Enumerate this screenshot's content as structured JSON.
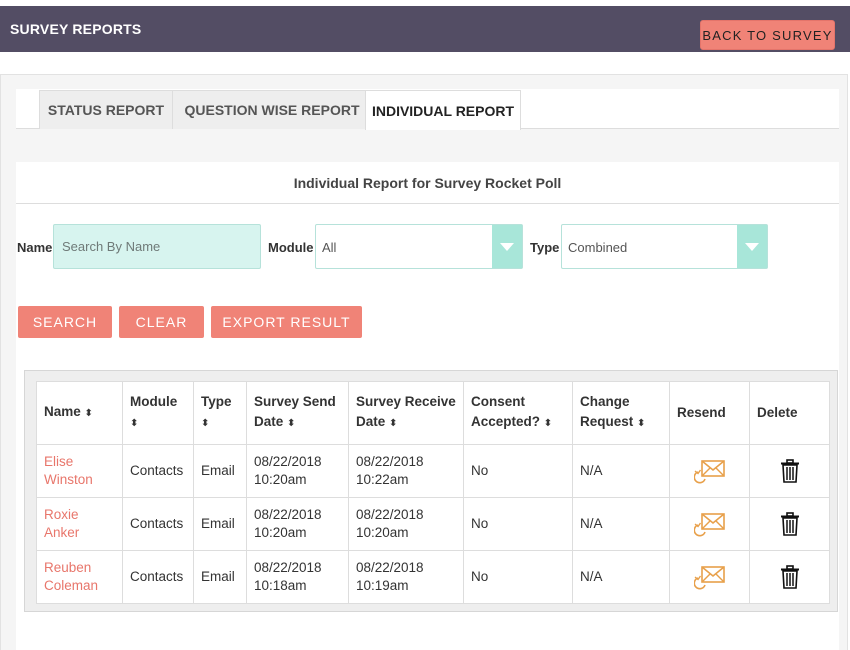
{
  "header": {
    "title": "SURVEY REPORTS",
    "back_label": "BACK TO SURVEY"
  },
  "tabs": [
    {
      "label": "STATUS REPORT"
    },
    {
      "label": "QUESTION WISE REPORT"
    },
    {
      "label": "INDIVIDUAL REPORT",
      "active": true
    }
  ],
  "panel": {
    "title": "Individual Report for Survey Rocket Poll"
  },
  "filters": {
    "name_label": "Name",
    "name_placeholder": "Search By Name",
    "module_label": "Module",
    "module_value": "All",
    "type_label": "Type",
    "type_value": "Combined"
  },
  "buttons": {
    "search": "SEARCH",
    "clear": "CLEAR",
    "export": "EXPORT RESULT"
  },
  "table": {
    "headers": {
      "name": "Name",
      "module": "Module",
      "type": "Type",
      "send_1": "Survey Send",
      "send_2": "Date",
      "receive_1": "Survey Receive",
      "receive_2": "Date",
      "consent_1": "Consent",
      "consent_2": "Accepted?",
      "change_1": "Change",
      "change_2": "Request",
      "resend": "Resend",
      "delete": "Delete"
    },
    "sort_glyph": "⬍",
    "rows": [
      {
        "name1": "Elise",
        "name2": "Winston",
        "module": "Contacts",
        "type": "Email",
        "send_date": "08/22/2018",
        "send_time": "10:20am",
        "recv_date": "08/22/2018",
        "recv_time": "10:22am",
        "consent": "No",
        "change": "N/A"
      },
      {
        "name1": "Roxie Anker",
        "name2": "",
        "module": "Contacts",
        "type": "Email",
        "send_date": "08/22/2018",
        "send_time": "10:20am",
        "recv_date": "08/22/2018",
        "recv_time": "10:20am",
        "consent": "No",
        "change": "N/A"
      },
      {
        "name1": "Reuben",
        "name2": "Coleman",
        "module": "Contacts",
        "type": "Email",
        "send_date": "08/22/2018",
        "send_time": "10:18am",
        "recv_date": "08/22/2018",
        "recv_time": "10:19am",
        "consent": "No",
        "change": "N/A"
      }
    ]
  },
  "icons": {
    "resend": "resend-mail-icon",
    "delete": "trash-icon",
    "accent": "#e8a04a"
  }
}
